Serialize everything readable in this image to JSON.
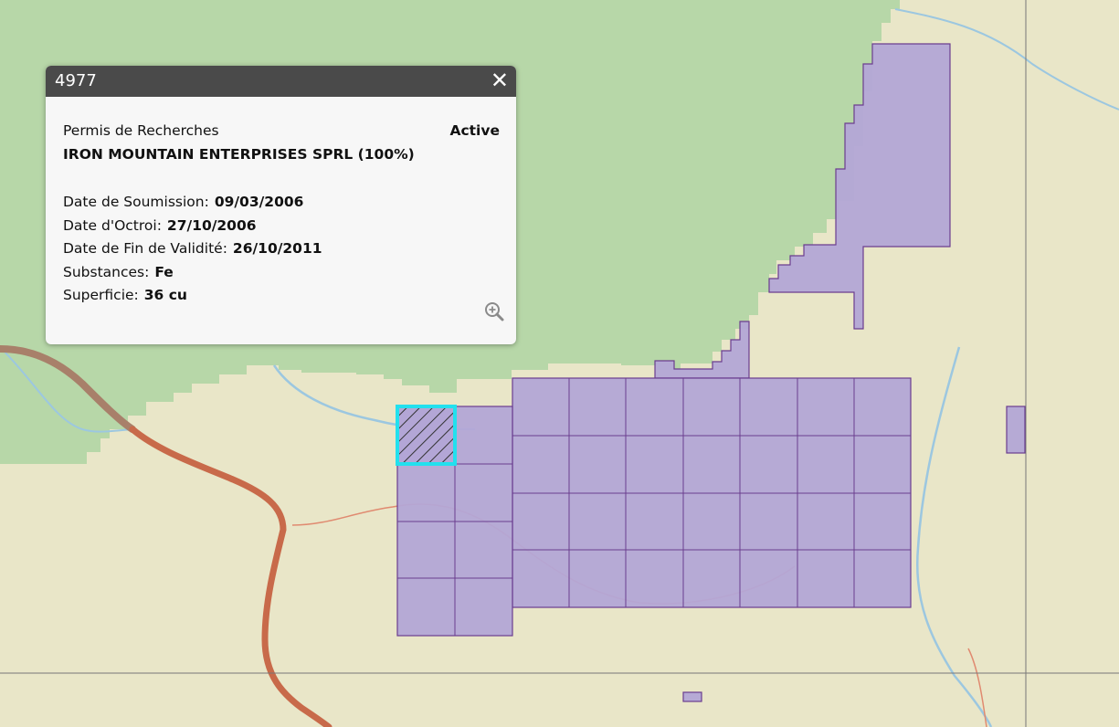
{
  "popup": {
    "title": "4977",
    "close_icon": "close-icon",
    "permit_type": "Permis de Recherches",
    "status": "Active",
    "holder": "IRON MOUNTAIN ENTERPRISES SPRL (100%)",
    "fields": [
      {
        "label": "Date de Soumission:",
        "value": "09/03/2006"
      },
      {
        "label": "Date d'Octroi:",
        "value": "27/10/2006"
      },
      {
        "label": "Date de Fin de Validité:",
        "value": "26/10/2011"
      },
      {
        "label": "Substances:",
        "value": "Fe"
      },
      {
        "label": "Superficie:",
        "value": "36 cu"
      }
    ],
    "zoom_icon": "zoom-in-icon"
  },
  "map": {
    "colors": {
      "forest": "#b7d7a8",
      "savanna": "#e9e6c8",
      "parcel_fill": "#b3a6d6",
      "parcel_stroke": "#6b3d8f",
      "selection": "#22e0ee",
      "river": "#9cc7e0",
      "road": "#c86a4a"
    }
  }
}
